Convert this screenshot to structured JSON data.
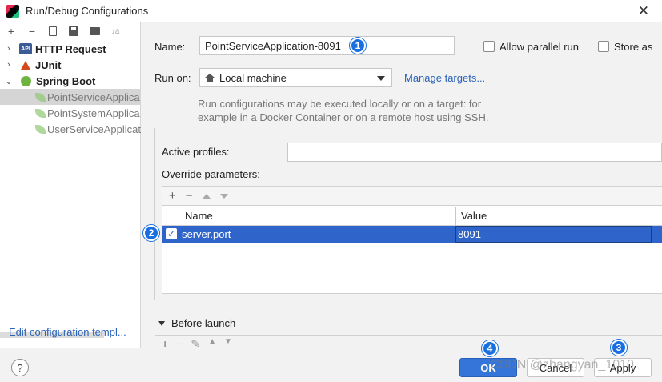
{
  "window": {
    "title": "Run/Debug Configurations",
    "close": "✕"
  },
  "toolbar": {
    "add": "+",
    "remove": "−",
    "sort": "↓a"
  },
  "tree": {
    "items": [
      {
        "label": "HTTP Request",
        "chevron": "›"
      },
      {
        "label": "JUnit",
        "chevron": "›"
      },
      {
        "label": "Spring Boot",
        "chevron": "⌄"
      },
      {
        "label": "PointServiceApplica"
      },
      {
        "label": "PointSystemApplica"
      },
      {
        "label": "UserServiceApplicat"
      }
    ],
    "api_icon_text": "API",
    "edit_link": "Edit configuration templ..."
  },
  "form": {
    "name_label": "Name:",
    "name_value": "PointServiceApplication-8091",
    "allow_parallel": "Allow parallel run",
    "store_as": "Store as",
    "run_on_label": "Run on:",
    "run_on_value": "Local machine",
    "manage_targets": "Manage targets...",
    "hint_line1": "Run configurations may be executed locally or on a target: for",
    "hint_line2": "example in a Docker Container or on a remote host using SSH.",
    "active_profiles_label": "Active profiles:",
    "override_label": "Override parameters:"
  },
  "table": {
    "tools": {
      "add": "+",
      "remove": "−"
    },
    "headers": {
      "name": "Name",
      "value": "Value"
    },
    "rows": [
      {
        "checked": "✓",
        "name": "server.port",
        "value": "8091"
      }
    ]
  },
  "before_launch": {
    "label": "Before launch",
    "add": "+",
    "remove": "−",
    "edit": "✎",
    "up": "▲",
    "down": "▼"
  },
  "badges": {
    "b1": "1",
    "b2": "2",
    "b3": "3",
    "b4": "4"
  },
  "footer": {
    "help": "?",
    "ok": "OK",
    "cancel": "Cancel",
    "apply": "Apply"
  },
  "watermark": "CSDN @zhangyan_1010",
  "colors": {
    "accent": "#3574d9",
    "selection": "#2f65ca",
    "link": "#2b63b8",
    "badge": "#1a6fe0"
  }
}
